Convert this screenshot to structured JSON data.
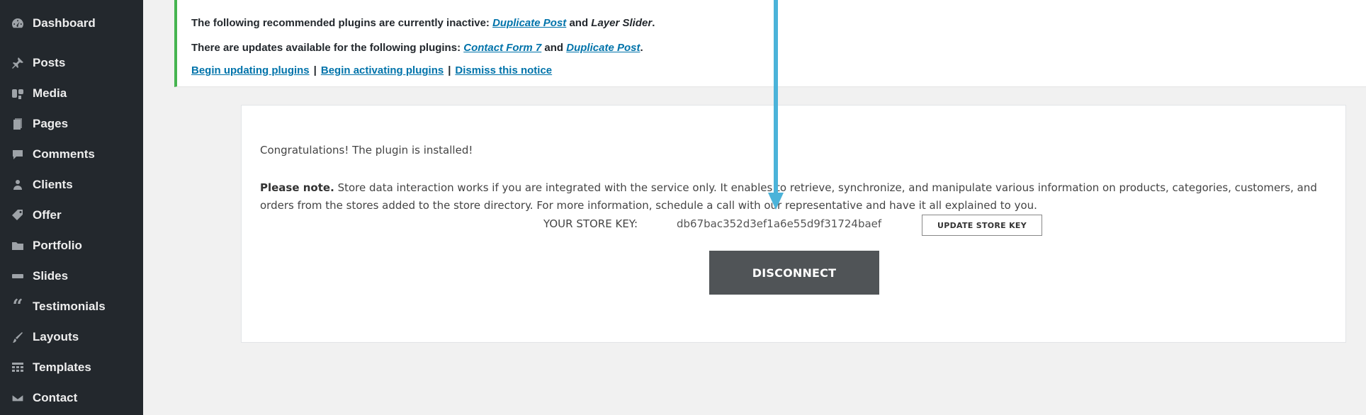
{
  "sidebar": {
    "items": [
      {
        "label": "Dashboard",
        "icon": "dashboard-icon"
      },
      {
        "label": "Posts",
        "icon": "pin-icon"
      },
      {
        "label": "Media",
        "icon": "media-icon"
      },
      {
        "label": "Pages",
        "icon": "pages-icon"
      },
      {
        "label": "Comments",
        "icon": "comment-icon"
      },
      {
        "label": "Clients",
        "icon": "users-icon"
      },
      {
        "label": "Offer",
        "icon": "tag-icon"
      },
      {
        "label": "Portfolio",
        "icon": "folder-icon"
      },
      {
        "label": "Slides",
        "icon": "slides-icon"
      },
      {
        "label": "Testimonials",
        "icon": "quote-icon"
      },
      {
        "label": "Layouts",
        "icon": "brush-icon"
      },
      {
        "label": "Templates",
        "icon": "grid-icon"
      },
      {
        "label": "Contact",
        "icon": "mail-icon"
      }
    ]
  },
  "notice": {
    "line1": {
      "prefix": "The following recommended plugins are currently inactive:",
      "link1": "Duplicate Post",
      "and": "and",
      "plain": "Layer Slider",
      "end": "."
    },
    "line2": {
      "prefix": "There are updates available for the following plugins:",
      "link1": "Contact Form 7",
      "and": "and",
      "link2": "Duplicate Post",
      "end": "."
    },
    "links": {
      "begin_updating": "Begin updating plugins",
      "begin_activating": "Begin activating plugins",
      "dismiss": "Dismiss this notice",
      "separator": "|"
    }
  },
  "panel": {
    "congrats": "Congratulations! The plugin is installed!",
    "note_bold": "Please note.",
    "note_text": "Store data interaction works if you are integrated with the service only. It enables to retrieve, synchronize, and manipulate various information on products, categories, customers, and orders from the stores added to the store directory. For more information, schedule a call with our representative and have it all explained to you.",
    "store_key_label": "YOUR STORE KEY:",
    "store_key_value": "db67bac352d3ef1a6e55d9f31724baef",
    "update_key_button": "UPDATE STORE KEY",
    "disconnect_button": "DISCONNECT"
  },
  "colors": {
    "sidebar_bg": "#23282d",
    "notice_border": "#46b450",
    "link": "#0073aa",
    "disconnect_bg": "#505457",
    "arrow": "#4bb3d9"
  }
}
